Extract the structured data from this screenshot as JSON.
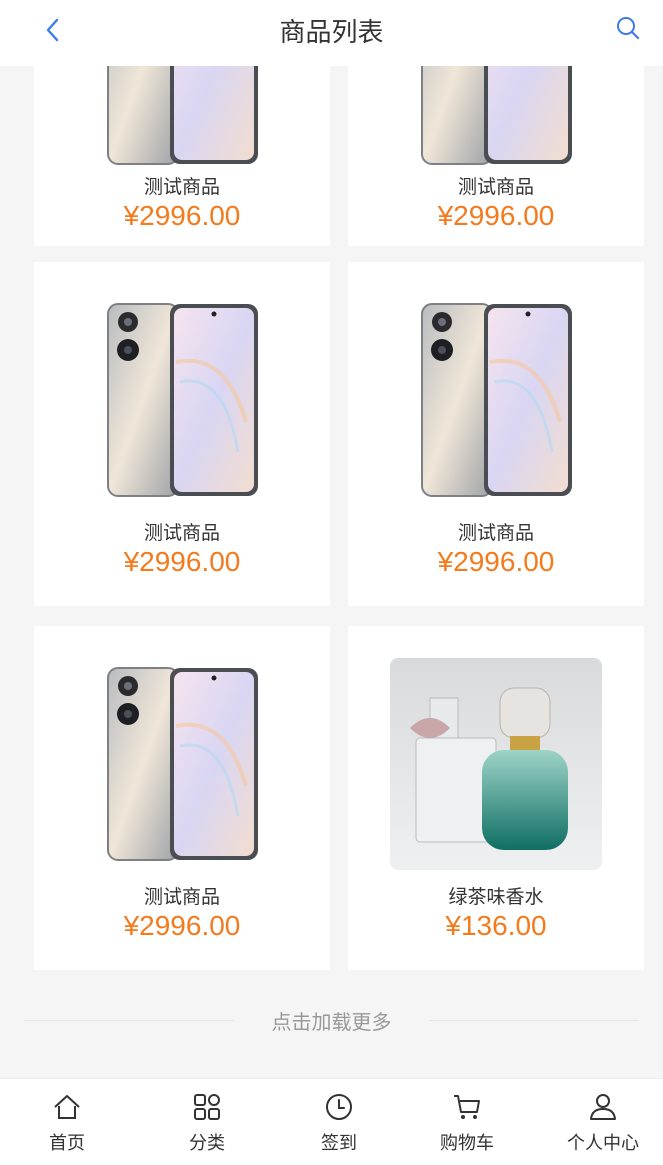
{
  "header": {
    "title": "商品列表"
  },
  "products": [
    {
      "name": "测试商品",
      "price": "¥2996.00",
      "image": "phone"
    },
    {
      "name": "测试商品",
      "price": "¥2996.00",
      "image": "phone"
    },
    {
      "name": "测试商品",
      "price": "¥2996.00",
      "image": "phone"
    },
    {
      "name": "测试商品",
      "price": "¥2996.00",
      "image": "phone"
    },
    {
      "name": "测试商品",
      "price": "¥2996.00",
      "image": "phone"
    },
    {
      "name": "绿茶味香水",
      "price": "¥136.00",
      "image": "perfume"
    }
  ],
  "load_more": "点击加载更多",
  "tabbar": [
    {
      "label": "首页",
      "icon": "home-icon"
    },
    {
      "label": "分类",
      "icon": "grid-icon"
    },
    {
      "label": "签到",
      "icon": "clock-icon"
    },
    {
      "label": "购物车",
      "icon": "cart-icon"
    },
    {
      "label": "个人中心",
      "icon": "user-icon"
    }
  ],
  "colors": {
    "accent": "#f37b1d",
    "link": "#3d7be8"
  }
}
